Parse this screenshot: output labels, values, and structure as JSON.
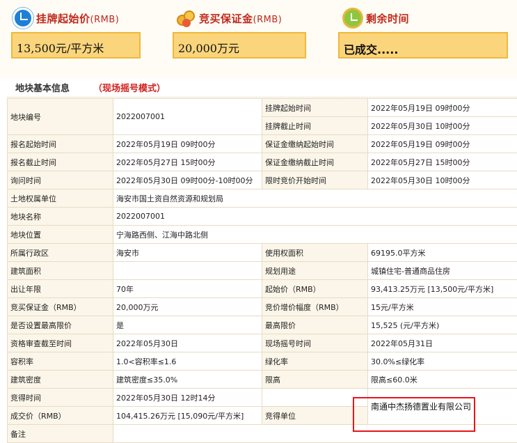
{
  "header": {
    "start_price_label": "挂牌起始价",
    "start_price_unit": "(RMB)",
    "start_price_value": "13,500元/平方米",
    "deposit_label": "竞买保证金",
    "deposit_unit": "(RMB)",
    "deposit_value": "20,000万元",
    "time_left_label": "剩余时间",
    "time_left_value": "已成交....."
  },
  "section": {
    "label": "地块基本信息",
    "mode": "（现场摇号模式）"
  },
  "rows": {
    "parcel_no_k": "地块编号",
    "parcel_no_v": "2022007001",
    "list_start_k": "挂牌起始时间",
    "list_start_v": "2022年05月19日 09时00分",
    "list_end_k": "挂牌截止时间",
    "list_end_v": "2022年05月30日 10时00分",
    "reg_start_k": "报名起始时间",
    "reg_start_v": "2022年05月19日 09时00分",
    "dep_start_k": "保证金缴纳起始时间",
    "dep_start_v": "2022年05月19日 09时00分",
    "reg_end_k": "报名截止时间",
    "reg_end_v": "2022年05月27日 15时00分",
    "dep_end_k": "保证金缴纳截止时间",
    "dep_end_v": "2022年05月27日 15时00分",
    "inquiry_k": "询问时间",
    "inquiry_v": "2022年05月30日 09时00分-10时00分",
    "limit_start_k": "限时竞价开始时间",
    "limit_start_v": "2022年05月30日 10时00分",
    "owner_k": "土地权属单位",
    "owner_v": "海安市国土资自然资源和规划局",
    "name_k": "地块名称",
    "name_v": "2022007001",
    "location_k": "地块位置",
    "location_v": "宁海路西侧、江海中路北侧",
    "district_k": "所属行政区",
    "district_v": "海安市",
    "use_area_k": "使用权面积",
    "use_area_v": "69195.0平方米",
    "build_area_k": "建筑面积",
    "build_area_v": "",
    "purpose_k": "规划用途",
    "purpose_v": "城镇住宅-普通商品住房",
    "term_k": "出让年限",
    "term_v": "70年",
    "start_price_k": "起始价（RMB）",
    "start_price_v": "93,413.25万元 [13,500元/平方米]",
    "deposit_k": "竞买保证金（RMB）",
    "deposit_v": "20,000万元",
    "increment_k": "竞价增价幅度（RMB）",
    "increment_v": "15元/平方米",
    "cap_set_k": "是否设置最高限价",
    "cap_set_v": "是",
    "cap_k": "最高限价",
    "cap_v": "15,525 (元/平方米)",
    "qual_k": "资格审查截至时间",
    "qual_v": "2022年05月30日",
    "lottery_k": "现场摇号时间",
    "lottery_v": "2022年05月31日",
    "far_k": "容积率",
    "far_v": "1.0<容积率≤1.6",
    "green_k": "绿化率",
    "green_v": "30.0%≤绿化率",
    "density_k": "建筑密度",
    "density_v": "建筑密度≤35.0%",
    "height_k": "限高",
    "height_v": "限高≤60.0米",
    "won_time_k": "竞得时间",
    "won_time_v": "2022年05月30日 12时14分",
    "deal_price_k": "成交价（RMB）",
    "deal_price_v": "104,415.26万元 [15,090元/平方米]",
    "winner_k": "竞得单位",
    "winner_v": "南通中杰扬德置业有限公司",
    "remark_k": "备注",
    "remark_v": ""
  },
  "colors": {
    "accent_red": "#c0281c",
    "value_box": "#fbd57b",
    "highlight_border": "#e8141c"
  },
  "icons": [
    "clock-icon",
    "coins-icon",
    "timer-icon"
  ]
}
